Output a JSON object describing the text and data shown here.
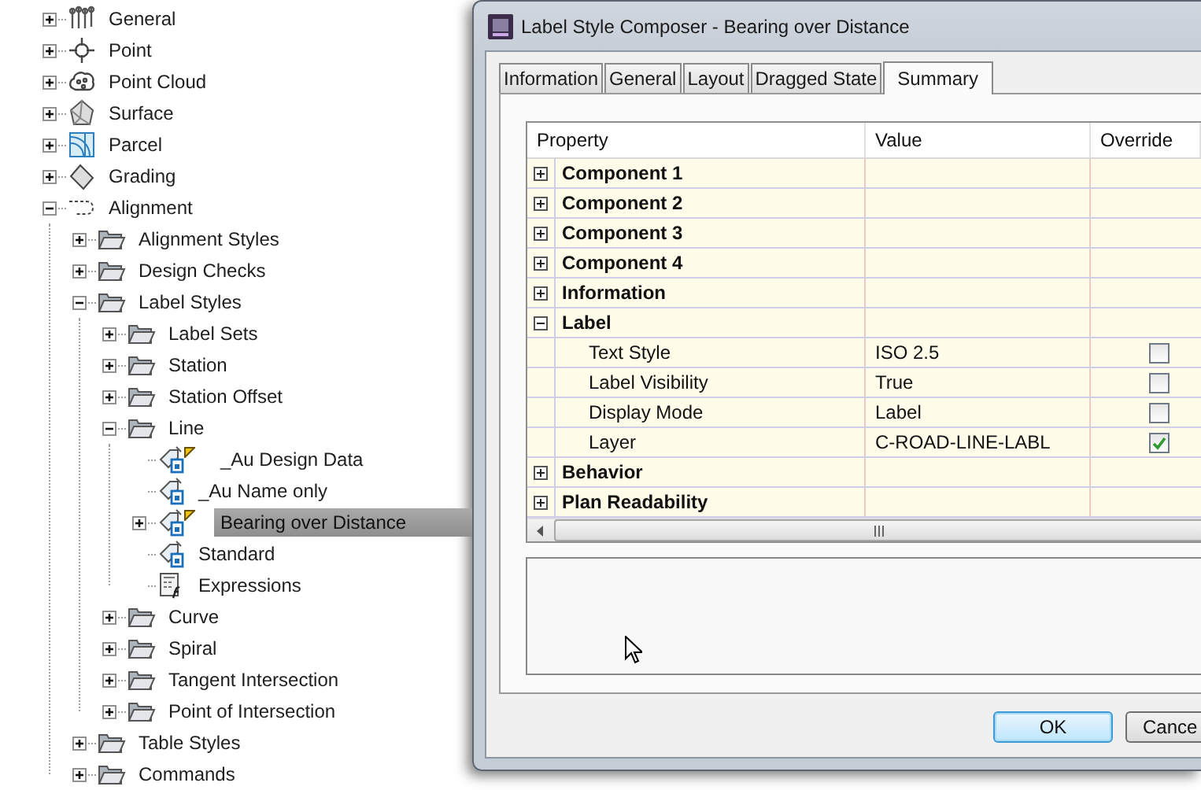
{
  "tree": {
    "nodes": [
      {
        "label": "General",
        "kind": "general",
        "expandable": true,
        "expanded": false,
        "selected": false,
        "flagged": false
      },
      {
        "label": "Point",
        "kind": "point",
        "expandable": true,
        "expanded": false,
        "selected": false,
        "flagged": false
      },
      {
        "label": "Point Cloud",
        "kind": "point-cloud",
        "expandable": true,
        "expanded": false,
        "selected": false,
        "flagged": false
      },
      {
        "label": "Surface",
        "kind": "surface",
        "expandable": true,
        "expanded": false,
        "selected": false,
        "flagged": false
      },
      {
        "label": "Parcel",
        "kind": "parcel",
        "expandable": true,
        "expanded": false,
        "selected": false,
        "flagged": false
      },
      {
        "label": "Grading",
        "kind": "grading",
        "expandable": true,
        "expanded": false,
        "selected": false,
        "flagged": false
      },
      {
        "label": "Alignment",
        "kind": "alignment",
        "expandable": true,
        "expanded": true,
        "selected": false,
        "flagged": false,
        "children": [
          {
            "label": "Alignment Styles",
            "kind": "folder",
            "expandable": true,
            "expanded": false,
            "selected": false,
            "flagged": false
          },
          {
            "label": "Design Checks",
            "kind": "folder",
            "expandable": true,
            "expanded": false,
            "selected": false,
            "flagged": false
          },
          {
            "label": "Label Styles",
            "kind": "folder",
            "expandable": true,
            "expanded": true,
            "selected": false,
            "flagged": false,
            "children": [
              {
                "label": "Label Sets",
                "kind": "folder",
                "expandable": true,
                "expanded": false,
                "selected": false,
                "flagged": false
              },
              {
                "label": "Station",
                "kind": "folder",
                "expandable": true,
                "expanded": false,
                "selected": false,
                "flagged": false
              },
              {
                "label": "Station Offset",
                "kind": "folder",
                "expandable": true,
                "expanded": false,
                "selected": false,
                "flagged": false
              },
              {
                "label": "Line",
                "kind": "folder",
                "expandable": true,
                "expanded": true,
                "selected": false,
                "flagged": false,
                "children": [
                  {
                    "label": "_Au Design Data",
                    "kind": "label-style",
                    "expandable": false,
                    "selected": false,
                    "flagged": true
                  },
                  {
                    "label": "_Au Name only",
                    "kind": "label-style",
                    "expandable": false,
                    "selected": false,
                    "flagged": false
                  },
                  {
                    "label": "Bearing over Distance",
                    "kind": "label-style",
                    "expandable": true,
                    "expanded": false,
                    "selected": true,
                    "flagged": true
                  },
                  {
                    "label": "Standard",
                    "kind": "label-style",
                    "expandable": false,
                    "selected": false,
                    "flagged": false
                  },
                  {
                    "label": "Expressions",
                    "kind": "expressions",
                    "expandable": false,
                    "selected": false,
                    "flagged": false
                  }
                ]
              },
              {
                "label": "Curve",
                "kind": "folder",
                "expandable": true,
                "expanded": false,
                "selected": false,
                "flagged": false
              },
              {
                "label": "Spiral",
                "kind": "folder",
                "expandable": true,
                "expanded": false,
                "selected": false,
                "flagged": false
              },
              {
                "label": "Tangent Intersection",
                "kind": "folder",
                "expandable": true,
                "expanded": false,
                "selected": false,
                "flagged": false
              },
              {
                "label": "Point of Intersection",
                "kind": "folder",
                "expandable": true,
                "expanded": false,
                "selected": false,
                "flagged": false
              }
            ]
          },
          {
            "label": "Table Styles",
            "kind": "folder",
            "expandable": true,
            "expanded": false,
            "selected": false,
            "flagged": false
          },
          {
            "label": "Commands",
            "kind": "folder",
            "expandable": true,
            "expanded": false,
            "selected": false,
            "flagged": false
          }
        ]
      }
    ]
  },
  "dialog": {
    "title": "Label Style Composer - Bearing over Distance",
    "tabs": [
      {
        "label": "Information",
        "selected": false
      },
      {
        "label": "General",
        "selected": false
      },
      {
        "label": "Layout",
        "selected": false
      },
      {
        "label": "Dragged State",
        "selected": false
      },
      {
        "label": "Summary",
        "selected": true
      }
    ],
    "table": {
      "columns": [
        "Property",
        "Value",
        "Override"
      ],
      "rows": [
        {
          "label": "Component 1",
          "expanded": false
        },
        {
          "label": "Component 2",
          "expanded": false
        },
        {
          "label": "Component 3",
          "expanded": false
        },
        {
          "label": "Component 4",
          "expanded": false
        },
        {
          "label": "Information",
          "expanded": false
        },
        {
          "label": "Label",
          "expanded": true,
          "children": [
            {
              "label": "Text Style",
              "value": "ISO 2.5",
              "override": false
            },
            {
              "label": "Label Visibility",
              "value": "True",
              "override": false
            },
            {
              "label": "Display Mode",
              "value": "Label",
              "override": false
            },
            {
              "label": "Layer",
              "value": "C-ROAD-LINE-LABL",
              "override": true
            }
          ]
        },
        {
          "label": "Behavior",
          "expanded": false
        },
        {
          "label": "Plan Readability",
          "expanded": false
        }
      ]
    },
    "buttons": [
      {
        "label": "OK",
        "default": true
      },
      {
        "label": "Cance",
        "default": false
      }
    ]
  }
}
